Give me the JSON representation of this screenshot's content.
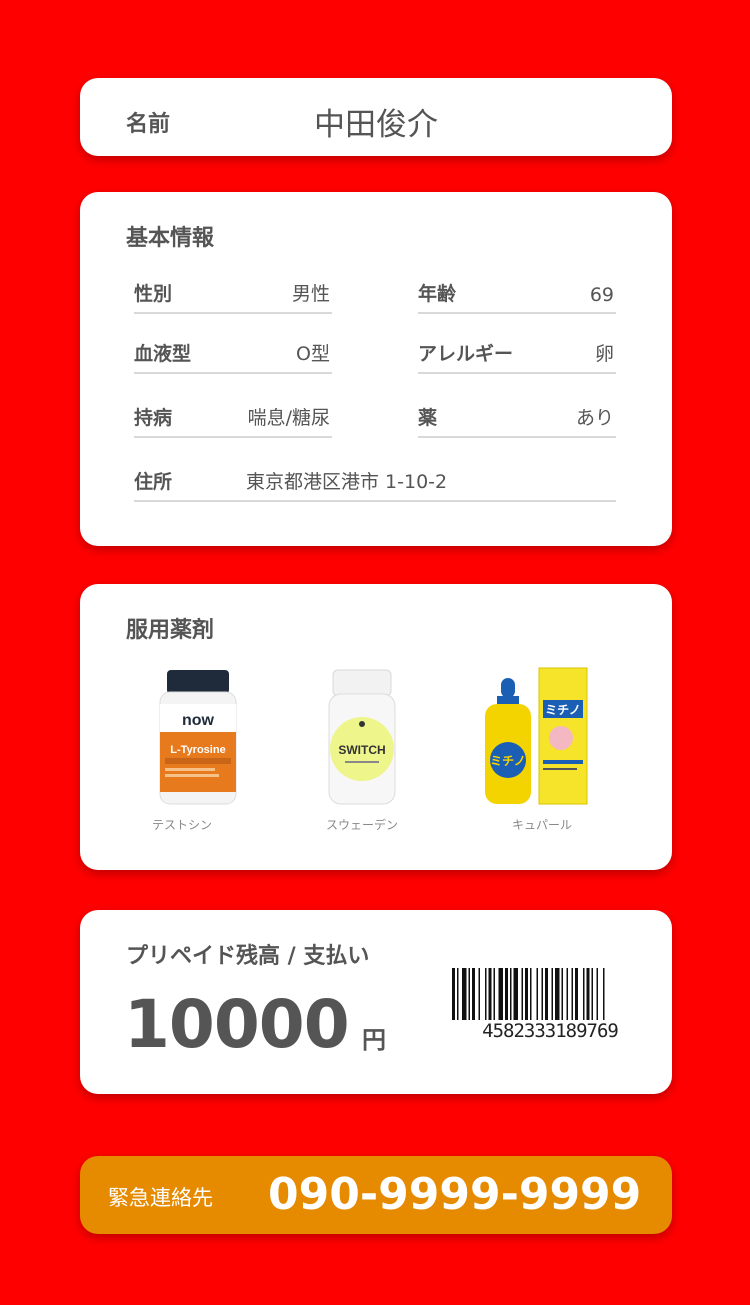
{
  "name_card": {
    "label": "名前",
    "value": "中田俊介"
  },
  "basic_info": {
    "title": "基本情報",
    "gender": {
      "label": "性別",
      "value": "男性"
    },
    "age": {
      "label": "年齢",
      "value": "69"
    },
    "blood": {
      "label": "血液型",
      "value": "O型"
    },
    "allergy": {
      "label": "アレルギー",
      "value": "卵"
    },
    "chronic": {
      "label": "持病",
      "value": "喘息/糖尿"
    },
    "medicine": {
      "label": "薬",
      "value": "あり"
    },
    "address": {
      "label": "住所",
      "value": "東京都港区港市 1-10-2"
    }
  },
  "medications": {
    "title": "服用薬剤",
    "items": [
      {
        "name": "テストシン",
        "icon": "supplement-bottle-icon",
        "brand": "now",
        "product": "L-Tyrosine"
      },
      {
        "name": "スウェーデン",
        "icon": "supplement-bottle-icon",
        "product": "SWITCH"
      },
      {
        "name": "キュパール",
        "icon": "nasal-spray-box-icon",
        "product": "ミチノ"
      }
    ]
  },
  "balance": {
    "title": "プリペイド残高 / 支払い",
    "amount": "10000",
    "unit": "円",
    "barcode_number": "4582333189769"
  },
  "emergency": {
    "label": "緊急連絡先",
    "phone": "090-9999-9999",
    "color": "#e68a00"
  },
  "colors": {
    "background": "#ff0000",
    "card": "#ffffff",
    "text": "#555555"
  }
}
